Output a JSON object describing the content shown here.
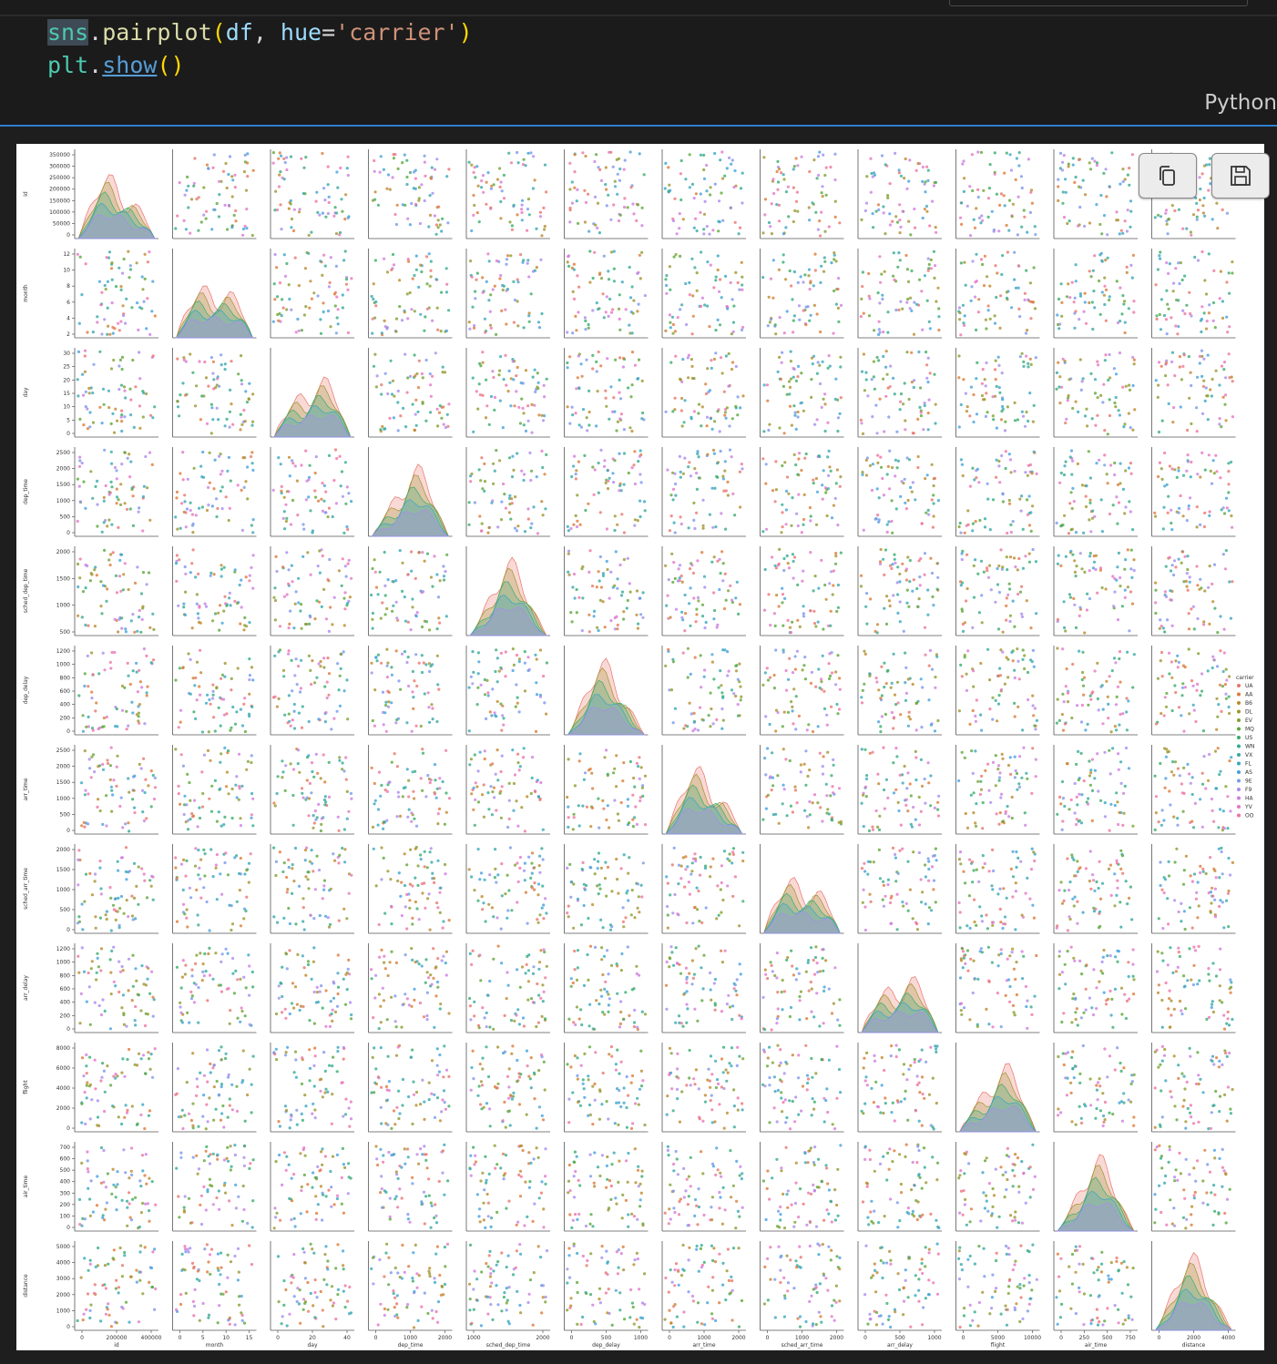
{
  "cell": {
    "code_lines": [
      [
        {
          "t": "sns",
          "c": "var sel"
        },
        {
          "t": ".",
          "c": "pun"
        },
        {
          "t": "pairplot",
          "c": "fn"
        },
        {
          "t": "(",
          "c": "par"
        },
        {
          "t": "df",
          "c": "id"
        },
        {
          "t": ", ",
          "c": "pun"
        },
        {
          "t": "hue",
          "c": "id"
        },
        {
          "t": "=",
          "c": "pun"
        },
        {
          "t": "'carrier'",
          "c": "str"
        },
        {
          "t": ")",
          "c": "par"
        }
      ],
      [
        {
          "t": "plt",
          "c": "var"
        },
        {
          "t": ".",
          "c": "pun"
        },
        {
          "t": "show",
          "c": "lnk"
        },
        {
          "t": "()",
          "c": "par"
        }
      ]
    ],
    "language": "Python"
  },
  "toolbar": {
    "copy_icon": "copy-icon",
    "save_icon": "save-icon"
  },
  "chart_data": {
    "type": "scatter",
    "subtype": "pairplot",
    "hue": "carrier",
    "diagonal": "kde",
    "variables": [
      "id",
      "month",
      "day",
      "dep_time",
      "sched_dep_time",
      "dep_delay",
      "arr_time",
      "sched_arr_time",
      "arr_delay",
      "flight",
      "air_time",
      "distance"
    ],
    "ylabels": [
      "id",
      "month",
      "day",
      "dep_time",
      "sched_dep_time",
      "dep_delay",
      "arr_time",
      "sched_arr_time",
      "arr_delay",
      "flight",
      "air_time",
      "distance"
    ],
    "xlabels": [
      "id",
      "month",
      "day",
      "dep_time",
      "sched_dep_time",
      "dep_delay",
      "arr_time",
      "sched_arr_time",
      "arr_delay",
      "flight",
      "air_time",
      "distance"
    ],
    "y_ticks": [
      [
        "0",
        "50000",
        "100000",
        "150000",
        "200000",
        "250000",
        "300000",
        "350000"
      ],
      [
        "2",
        "4",
        "6",
        "8",
        "10",
        "12"
      ],
      [
        "0",
        "5",
        "10",
        "15",
        "20",
        "25",
        "30"
      ],
      [
        "0",
        "500",
        "1000",
        "1500",
        "2000",
        "2500"
      ],
      [
        "500",
        "1000",
        "1500",
        "2000"
      ],
      [
        "0",
        "200",
        "400",
        "600",
        "800",
        "1000",
        "1200"
      ],
      [
        "0",
        "500",
        "1000",
        "1500",
        "2000",
        "2500"
      ],
      [
        "0",
        "500",
        "1000",
        "1500",
        "2000"
      ],
      [
        "0",
        "200",
        "400",
        "600",
        "800",
        "1000",
        "1200"
      ],
      [
        "0",
        "2000",
        "4000",
        "6000",
        "8000"
      ],
      [
        "0",
        "100",
        "200",
        "300",
        "400",
        "500",
        "600",
        "700"
      ],
      [
        "0",
        "1000",
        "2000",
        "3000",
        "4000",
        "5000"
      ]
    ],
    "x_ticks": [
      [
        "0",
        "200000",
        "400000"
      ],
      [
        "0",
        "5",
        "10",
        "15"
      ],
      [
        "0",
        "20",
        "40"
      ],
      [
        "0",
        "1000",
        "2000"
      ],
      [
        "1000",
        "2000"
      ],
      [
        "0",
        "500",
        "1000"
      ],
      [
        "0",
        "1000",
        "2000"
      ],
      [
        "0",
        "1000",
        "2000"
      ],
      [
        "0",
        "500",
        "1000"
      ],
      [
        "0",
        "5000",
        "10000"
      ],
      [
        "0",
        "250",
        "500",
        "750"
      ],
      [
        "0",
        "2000",
        "4000"
      ]
    ],
    "ranges": {
      "id": [
        0,
        336776
      ],
      "month": [
        1,
        12
      ],
      "day": [
        1,
        31
      ],
      "dep_time": [
        1,
        2400
      ],
      "sched_dep_time": [
        106,
        2359
      ],
      "dep_delay": [
        -43,
        1301
      ],
      "arr_time": [
        1,
        2400
      ],
      "sched_arr_time": [
        1,
        2359
      ],
      "arr_delay": [
        -86,
        1272
      ],
      "flight": [
        1,
        8500
      ],
      "air_time": [
        20,
        695
      ],
      "distance": [
        17,
        4983
      ]
    },
    "legend": {
      "title": "carrier",
      "placement": "right",
      "entries": [
        "UA",
        "AA",
        "B6",
        "DL",
        "EV",
        "MQ",
        "US",
        "WN",
        "VX",
        "FL",
        "AS",
        "9E",
        "F9",
        "HA",
        "YV",
        "OO"
      ],
      "colors": [
        "#e8756b",
        "#dd7b38",
        "#bd8a2d",
        "#a09531",
        "#83a031",
        "#5ea83b",
        "#3aad6b",
        "#36ab91",
        "#37a8a9",
        "#3aa6c2",
        "#46a1de",
        "#7b97ec",
        "#a98bed",
        "#cd7ee0",
        "#e477c5",
        "#ed74a4"
      ]
    }
  }
}
